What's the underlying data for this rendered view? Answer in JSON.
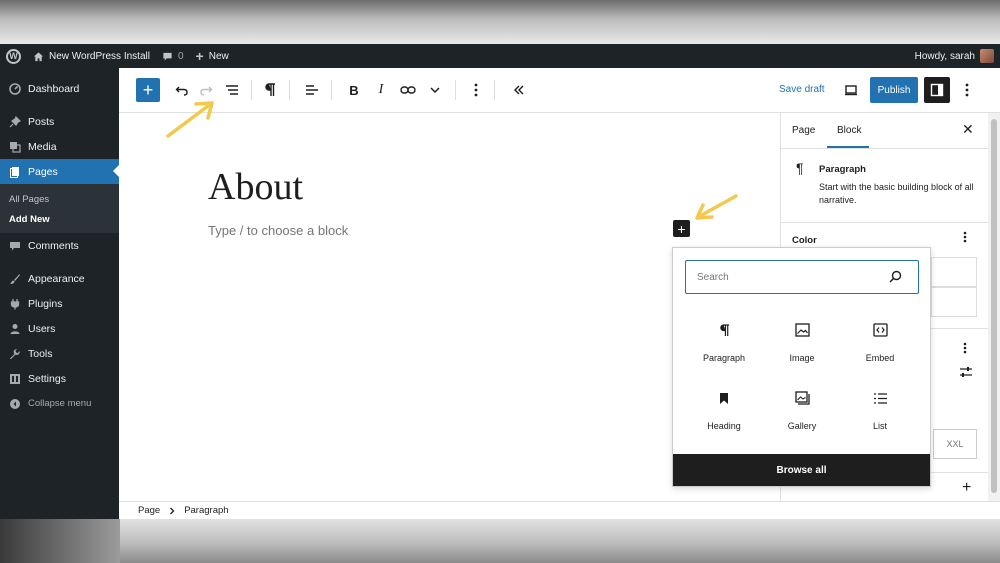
{
  "adminbar": {
    "site_name": "New WordPress Install",
    "comments_count": "0",
    "new_label": "New",
    "greeting": "Howdy, sarah"
  },
  "sidebar": {
    "items": [
      {
        "label": "Dashboard",
        "icon": "dashboard-icon"
      },
      {
        "label": "Posts",
        "icon": "pin-icon"
      },
      {
        "label": "Media",
        "icon": "media-icon"
      },
      {
        "label": "Pages",
        "icon": "pages-icon"
      },
      {
        "label": "Comments",
        "icon": "comment-icon"
      },
      {
        "label": "Appearance",
        "icon": "brush-icon"
      },
      {
        "label": "Plugins",
        "icon": "plug-icon"
      },
      {
        "label": "Users",
        "icon": "user-icon"
      },
      {
        "label": "Tools",
        "icon": "wrench-icon"
      },
      {
        "label": "Settings",
        "icon": "settings-icon"
      }
    ],
    "submenu": [
      "All Pages",
      "Add New"
    ],
    "collapse_label": "Collapse menu"
  },
  "toolbar": {
    "save_draft": "Save draft",
    "publish": "Publish"
  },
  "canvas": {
    "title": "About",
    "placeholder": "Type / to choose a block"
  },
  "inserter": {
    "search_placeholder": "Search",
    "blocks": [
      {
        "label": "Paragraph",
        "icon": "paragraph-icon"
      },
      {
        "label": "Image",
        "icon": "image-icon"
      },
      {
        "label": "Embed",
        "icon": "embed-icon"
      },
      {
        "label": "Heading",
        "icon": "bookmark-icon"
      },
      {
        "label": "Gallery",
        "icon": "gallery-icon"
      },
      {
        "label": "List",
        "icon": "list-icon"
      }
    ],
    "browse_all": "Browse all"
  },
  "settings_panel": {
    "tabs": [
      "Page",
      "Block"
    ],
    "active_tab": "Block",
    "block_name": "Paragraph",
    "block_description": "Start with the basic building block of all narrative.",
    "color_label": "Color",
    "font_size_value": "XXL"
  },
  "footer": {
    "breadcrumb": [
      "Page",
      "Paragraph"
    ]
  },
  "colors": {
    "accent": "#2271b1",
    "admin_dark": "#1d2327",
    "annotation_arrow": "#f2c94c"
  }
}
